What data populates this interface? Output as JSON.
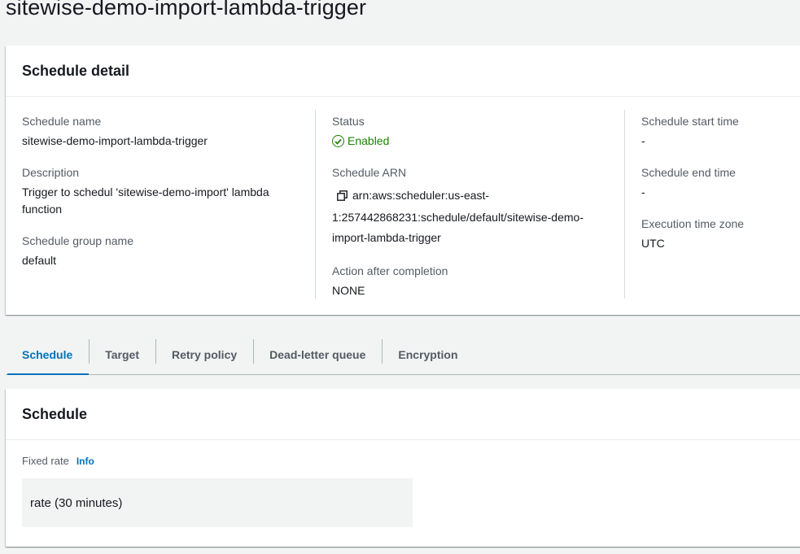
{
  "page": {
    "title": "sitewise-demo-import-lambda-trigger"
  },
  "detail": {
    "header": "Schedule detail",
    "schedule_name_label": "Schedule name",
    "schedule_name": "sitewise-demo-import-lambda-trigger",
    "description_label": "Description",
    "description": "Trigger to schedul 'sitewise-demo-import' lambda function",
    "group_label": "Schedule group name",
    "group": "default",
    "status_label": "Status",
    "status": "Enabled",
    "arn_label": "Schedule ARN",
    "arn_line1": "arn:aws:scheduler:us-east-",
    "arn_line2": "1:257442868231:schedule/default/sitewise-demo-",
    "arn_line3": "import-lambda-trigger",
    "action_label": "Action after completion",
    "action": "NONE",
    "start_label": "Schedule start time",
    "start": "-",
    "end_label": "Schedule end time",
    "end": "-",
    "tz_label": "Execution time zone",
    "tz": "UTC"
  },
  "tabs": [
    {
      "label": "Schedule",
      "active": true
    },
    {
      "label": "Target",
      "active": false
    },
    {
      "label": "Retry policy",
      "active": false
    },
    {
      "label": "Dead-letter queue",
      "active": false
    },
    {
      "label": "Encryption",
      "active": false
    }
  ],
  "schedule": {
    "header": "Schedule",
    "fixed_rate_label": "Fixed rate",
    "info_link": "Info",
    "rate": "rate (30 minutes)"
  },
  "colors": {
    "accent": "#0073bb",
    "success": "#1d8102"
  },
  "icons": {
    "status": "check-circle-icon",
    "copy": "copy-icon"
  }
}
